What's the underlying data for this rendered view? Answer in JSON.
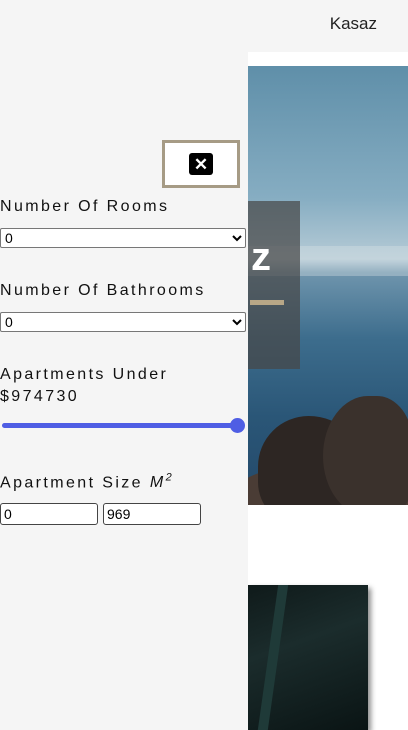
{
  "header": {
    "brand": "Kasaz"
  },
  "hero": {
    "letter": "z"
  },
  "filters": {
    "rooms": {
      "label": "Number Of Rooms",
      "value": "0"
    },
    "bathrooms": {
      "label": "Number Of Bathrooms",
      "value": "0"
    },
    "price": {
      "label_line1": "Apartments Under",
      "label_line2": "$974730",
      "slider_fraction": 1.0
    },
    "size": {
      "label": "Apartment Size",
      "unit": "M",
      "unit_exp": "2",
      "min_value": "0",
      "max_value": "969"
    }
  },
  "icons": {
    "close": "close-icon"
  },
  "colors": {
    "accent": "#4f5ee4",
    "close_border": "#a69b85",
    "sidebar_bg": "#f5f5f5"
  }
}
